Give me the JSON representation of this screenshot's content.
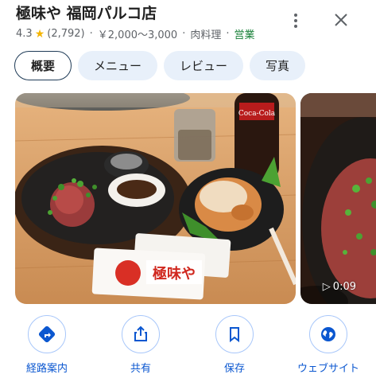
{
  "place": {
    "title": "極味や 福岡パルコ店",
    "rating": "4.3",
    "review_count": "(2,792)",
    "price_range": "￥2,000～3,000",
    "category": "肉料理",
    "status": "営業",
    "colors": {
      "status_open": "#188038",
      "accent": "#0b57d0",
      "star": "#f4b400"
    }
  },
  "header_icons": {
    "more": "more-vert-icon",
    "close": "close-icon"
  },
  "tabs": [
    {
      "label": "概要",
      "active": true
    },
    {
      "label": "メニュー",
      "active": false
    },
    {
      "label": "レビュー",
      "active": false
    },
    {
      "label": "写真",
      "active": false
    }
  ],
  "photos": {
    "main_sign_text": "極味や",
    "main_bottle_text": "Coca-Cola",
    "video_duration": "0:09"
  },
  "actions": [
    {
      "label": "経路案内",
      "icon": "directions-icon"
    },
    {
      "label": "共有",
      "icon": "share-icon"
    },
    {
      "label": "保存",
      "icon": "bookmark-icon"
    },
    {
      "label": "ウェブサイト",
      "icon": "globe-icon"
    }
  ]
}
